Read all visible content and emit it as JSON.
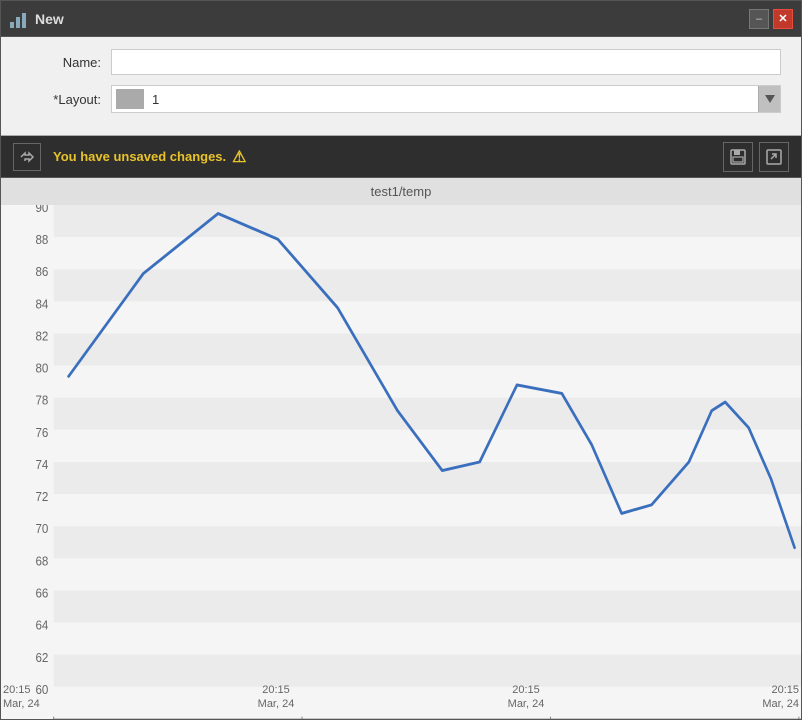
{
  "titleBar": {
    "title": "New",
    "minimizeLabel": "–",
    "closeLabel": "✕"
  },
  "form": {
    "nameLabel": "Name:",
    "layoutLabel": "*Layout:",
    "layoutValue": "1",
    "namePlaceholder": ""
  },
  "toolbar": {
    "unsavedMessage": "You have unsaved changes.",
    "warningSymbol": "⚠"
  },
  "chart": {
    "title": "test1/temp",
    "yAxisMin": 60,
    "yAxisMax": 90,
    "yStep": 2,
    "xLabels": [
      {
        "time": "20:15",
        "date": "Mar, 24"
      },
      {
        "time": "20:15",
        "date": "Mar, 24"
      },
      {
        "time": "20:15",
        "date": "Mar, 24"
      },
      {
        "time": "20:15",
        "date": "Mar, 24"
      }
    ],
    "series": [
      {
        "x": 0.02,
        "y": 80
      },
      {
        "x": 0.12,
        "y": 86
      },
      {
        "x": 0.22,
        "y": 89.5
      },
      {
        "x": 0.3,
        "y": 88
      },
      {
        "x": 0.38,
        "y": 84
      },
      {
        "x": 0.46,
        "y": 78
      },
      {
        "x": 0.52,
        "y": 74.5
      },
      {
        "x": 0.57,
        "y": 75
      },
      {
        "x": 0.62,
        "y": 79.5
      },
      {
        "x": 0.68,
        "y": 79
      },
      {
        "x": 0.72,
        "y": 76
      },
      {
        "x": 0.76,
        "y": 72
      },
      {
        "x": 0.8,
        "y": 72.5
      },
      {
        "x": 0.85,
        "y": 75
      },
      {
        "x": 0.88,
        "y": 78
      },
      {
        "x": 0.9,
        "y": 78.5
      },
      {
        "x": 0.93,
        "y": 77
      },
      {
        "x": 0.96,
        "y": 74
      },
      {
        "x": 0.99,
        "y": 70
      }
    ],
    "colors": {
      "line": "#3a6fbe",
      "gridEvenBg": "#ebebeb",
      "gridOddBg": "#f5f5f5"
    }
  }
}
